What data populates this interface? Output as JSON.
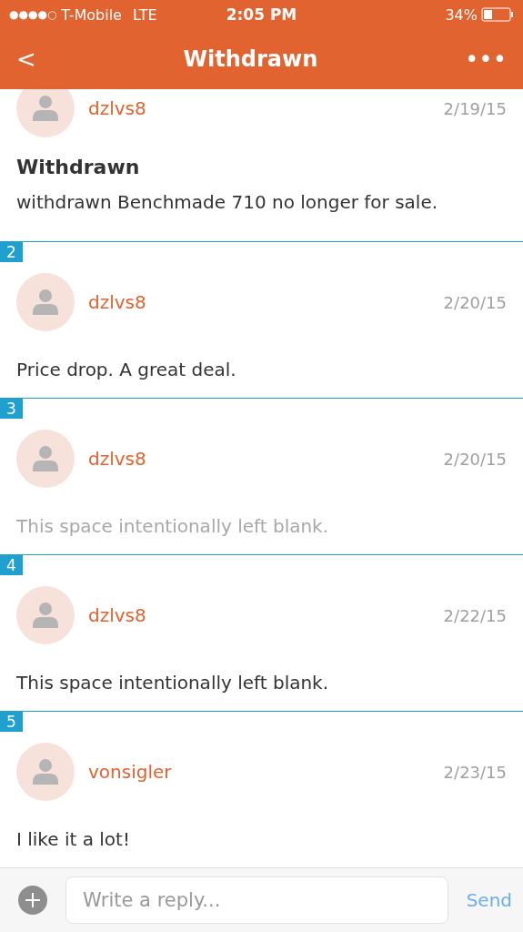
{
  "status_bar": {
    "signal_dots": "●●●●○",
    "carrier": "T-Mobile",
    "network": "LTE",
    "time": "2:05 PM",
    "battery": "34%"
  },
  "nav": {
    "back": "<",
    "title": "Withdrawn",
    "more": "•••"
  },
  "posts": [
    {
      "user": "dzlvs8",
      "date": "2/19/15",
      "title": "Withdrawn",
      "body": "withdrawn Benchmade 710 no longer for sale.",
      "dimmed": false
    },
    {
      "number": "2",
      "user": "dzlvs8",
      "date": "2/20/15",
      "body": "Price drop. A great deal.",
      "dimmed": false
    },
    {
      "number": "3",
      "user": "dzlvs8",
      "date": "2/20/15",
      "body": "This space intentionally left blank.",
      "dimmed": true
    },
    {
      "number": "4",
      "user": "dzlvs8",
      "date": "2/22/15",
      "body": "This space intentionally left blank.",
      "dimmed": false
    },
    {
      "number": "5",
      "user": "vonsigler",
      "date": "2/23/15",
      "body": "I like it a lot!",
      "dimmed": false
    }
  ],
  "composer": {
    "placeholder": "Write a reply...",
    "send": "Send"
  }
}
